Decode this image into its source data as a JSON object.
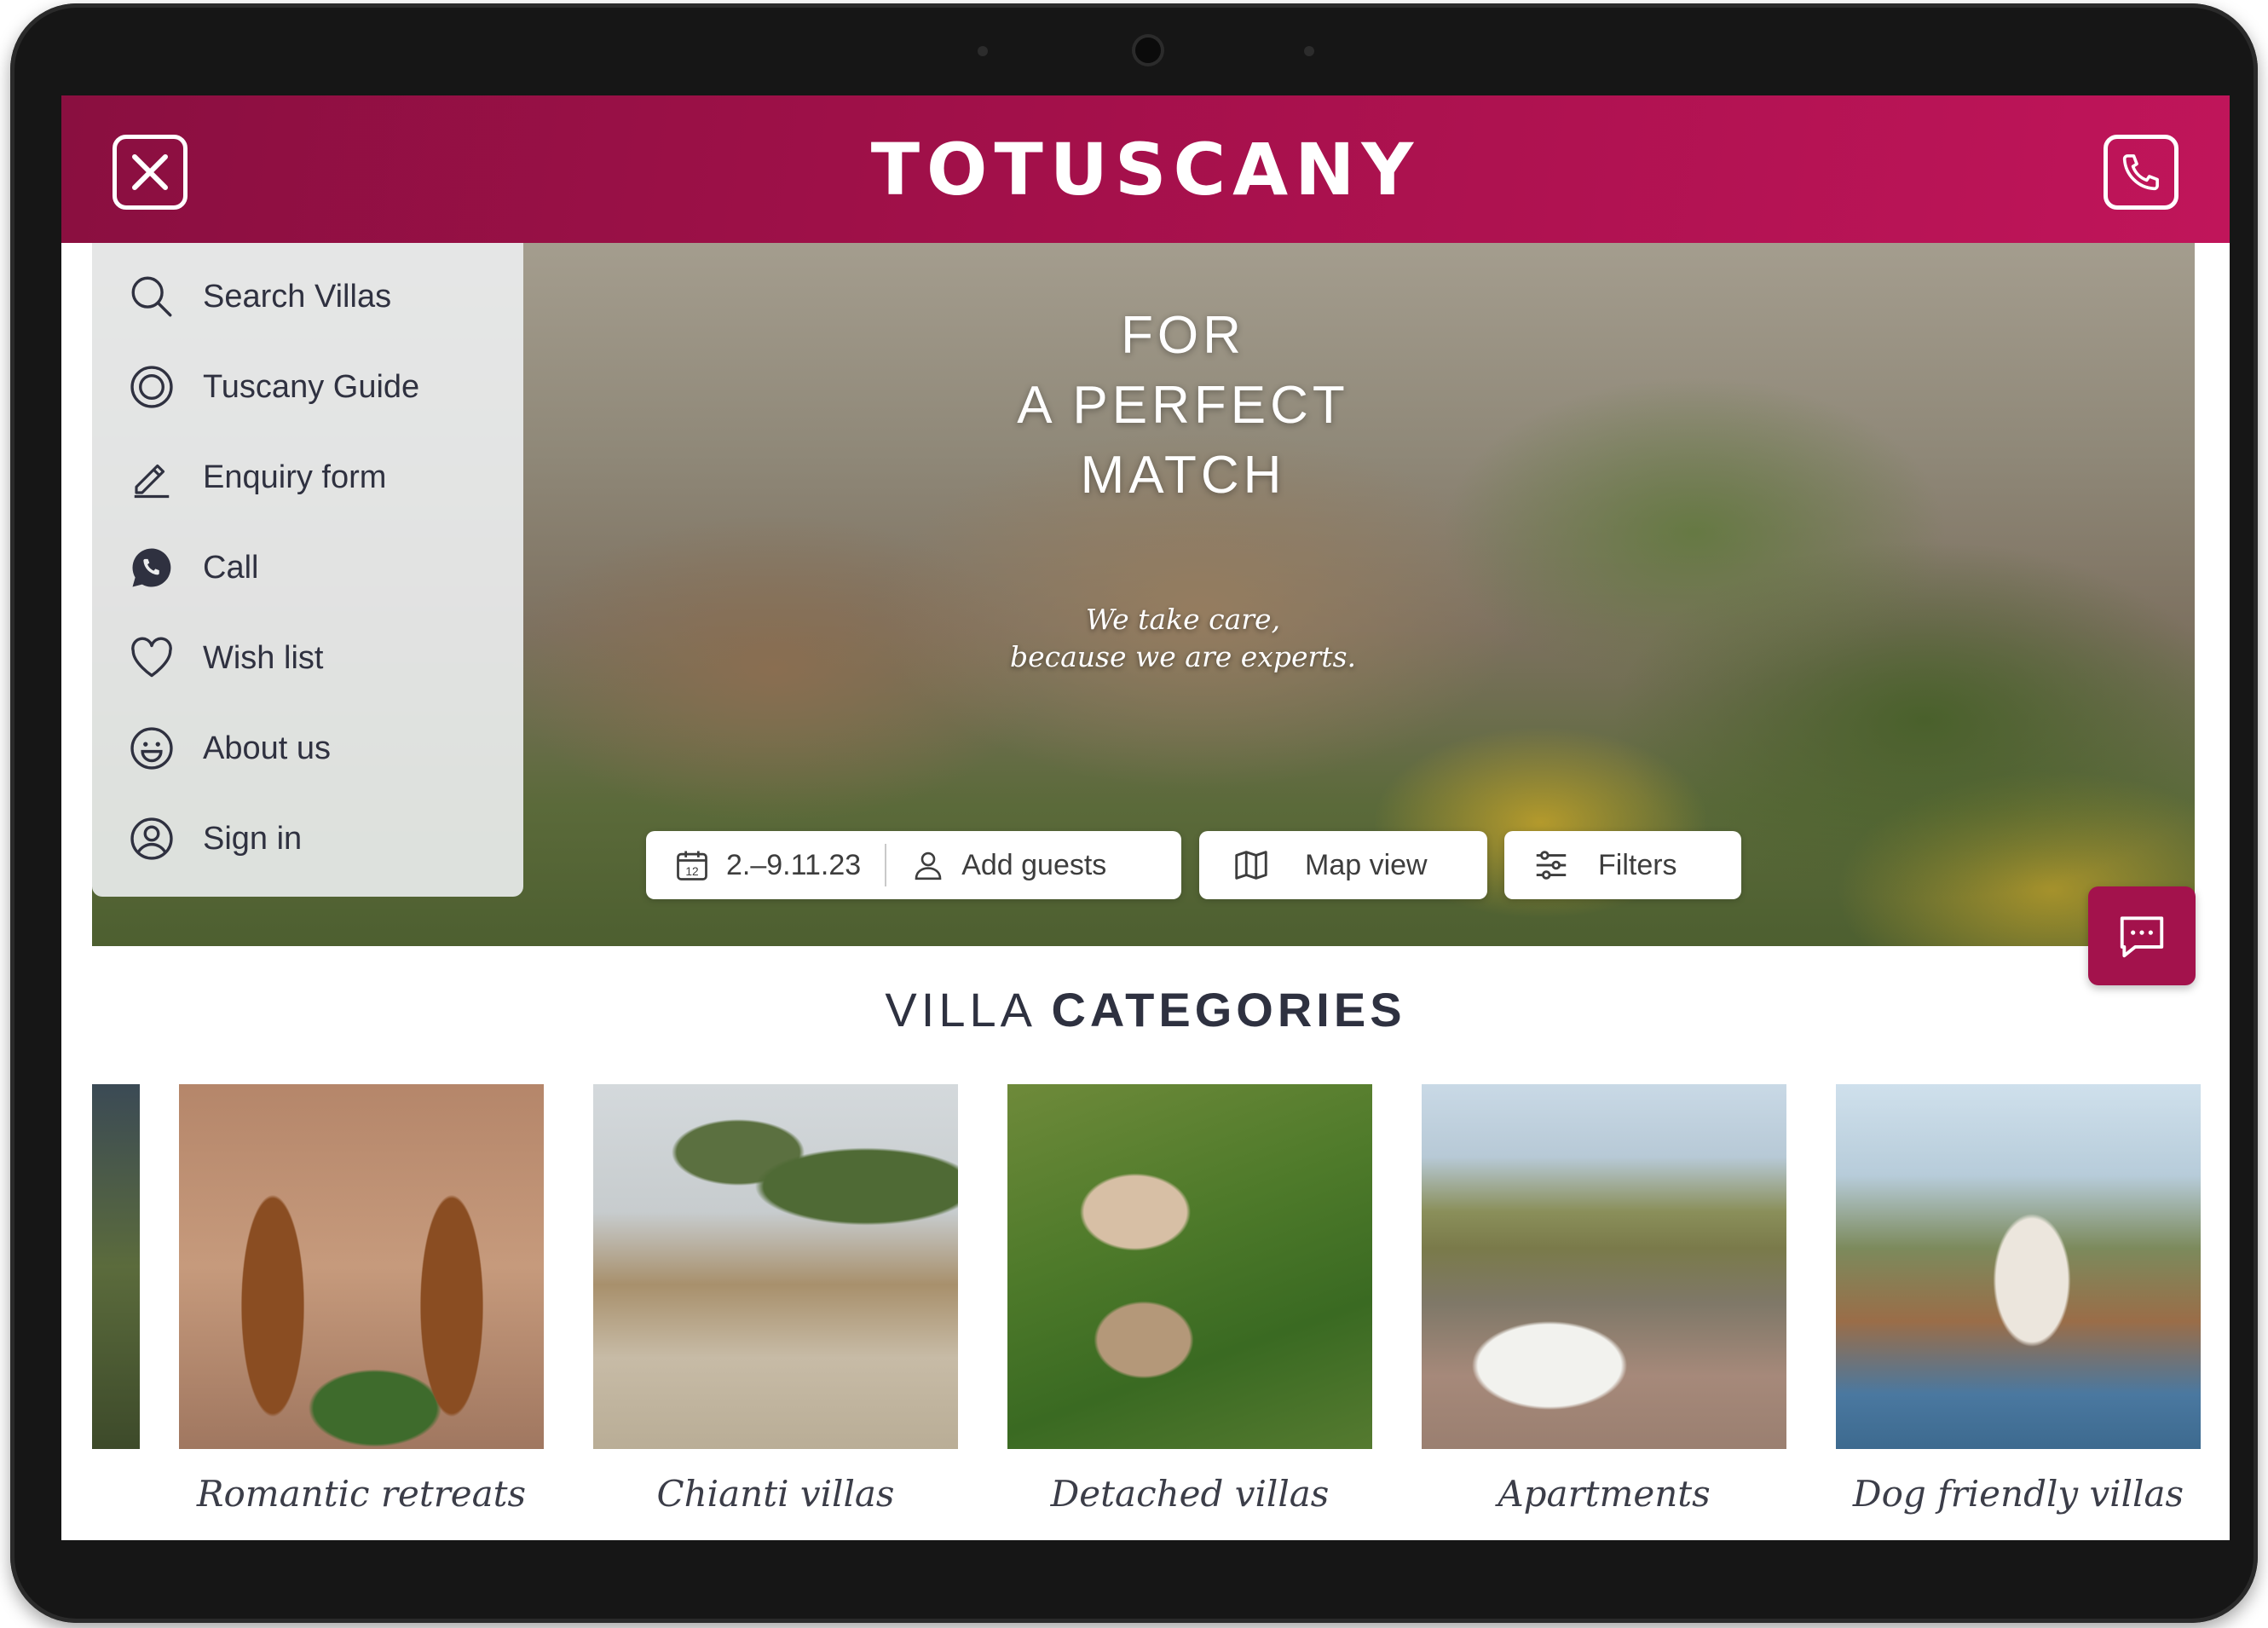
{
  "brand": {
    "logo_text": "TOTUSCANY",
    "accent": "#a3124c"
  },
  "header": {
    "close_icon": "close-icon",
    "phone_icon": "phone-icon"
  },
  "menu": {
    "items": [
      {
        "label": "Search Villas",
        "icon": "search-icon"
      },
      {
        "label": "Tuscany Guide",
        "icon": "target-icon"
      },
      {
        "label": "Enquiry form",
        "icon": "pencil-icon"
      },
      {
        "label": "Call",
        "icon": "call-bubble-icon"
      },
      {
        "label": "Wish list",
        "icon": "heart-icon"
      },
      {
        "label": "About us",
        "icon": "smiley-icon"
      },
      {
        "label": "Sign in",
        "icon": "user-circle-icon"
      }
    ]
  },
  "hero": {
    "title_lines": [
      "FOR",
      "A PERFECT",
      "MATCH"
    ],
    "subtitle_lines": [
      "We take care,",
      "because we are experts."
    ]
  },
  "search_bar": {
    "dates": "2.–9.11.23",
    "calendar_day": "12",
    "guests": "Add guests",
    "map": "Map view",
    "filters": "Filters"
  },
  "categories": {
    "title_light": "VILLA",
    "title_bold": "CATEGORIES",
    "items": [
      {
        "label": "Romantic retreats"
      },
      {
        "label": "Chianti villas"
      },
      {
        "label": "Detached villas"
      },
      {
        "label": "Apartments"
      },
      {
        "label": "Dog friendly villas"
      }
    ]
  }
}
